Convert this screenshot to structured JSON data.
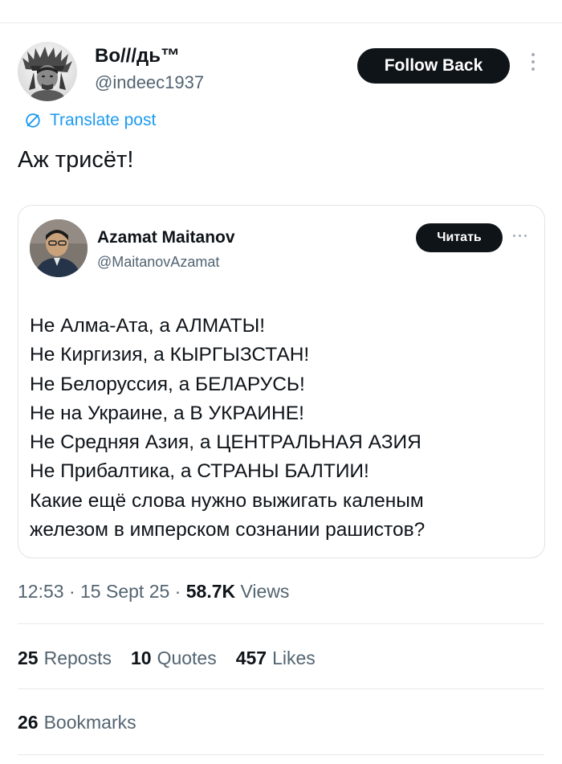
{
  "author": {
    "name": "Во///дь™",
    "handle": "@indeec1937",
    "avatar_icon": "person-headdress-avatar"
  },
  "follow_button": "Follow Back",
  "more_icon": "more-options-icon",
  "translate": {
    "icon": "translate-icon",
    "label": "Translate post"
  },
  "post_text": "Аж трисёт!",
  "quote": {
    "name": "Azamat Maitanov",
    "handle": "@MaitanovAzamat",
    "read_button": "Читать",
    "lines": [
      "Не Алма-Ата, а АЛМАТЫ!",
      "Не Киргизия, а КЫРГЫЗСТАН!",
      "Не Белоруссия, а БЕЛАРУСЬ!",
      "Не на Украине, а В УКРАИНЕ!",
      "Не Средняя Азия, а ЦЕНТРАЛЬНАЯ АЗИЯ",
      "Не Прибалтика, а СТРАНЫ БАЛТИИ!",
      "Какие ещё слова нужно выжигать каленым",
      "железом в имперском сознании рашистов?"
    ]
  },
  "meta": {
    "time": "12:53",
    "sep1": " · ",
    "date": "15 Sept 25",
    "sep2": " · ",
    "views_count": "58.7K",
    "views_label": " Views"
  },
  "stats": {
    "reposts_count": "25",
    "reposts_label": "Reposts",
    "quotes_count": "10",
    "quotes_label": "Quotes",
    "likes_count": "457",
    "likes_label": "Likes",
    "bookmarks_count": "26",
    "bookmarks_label": "Bookmarks"
  },
  "colors": {
    "text": "#0f1419",
    "secondary": "#536471",
    "link": "#1d9bf0",
    "button_bg": "#0f1419",
    "border": "#dfe3e6"
  }
}
